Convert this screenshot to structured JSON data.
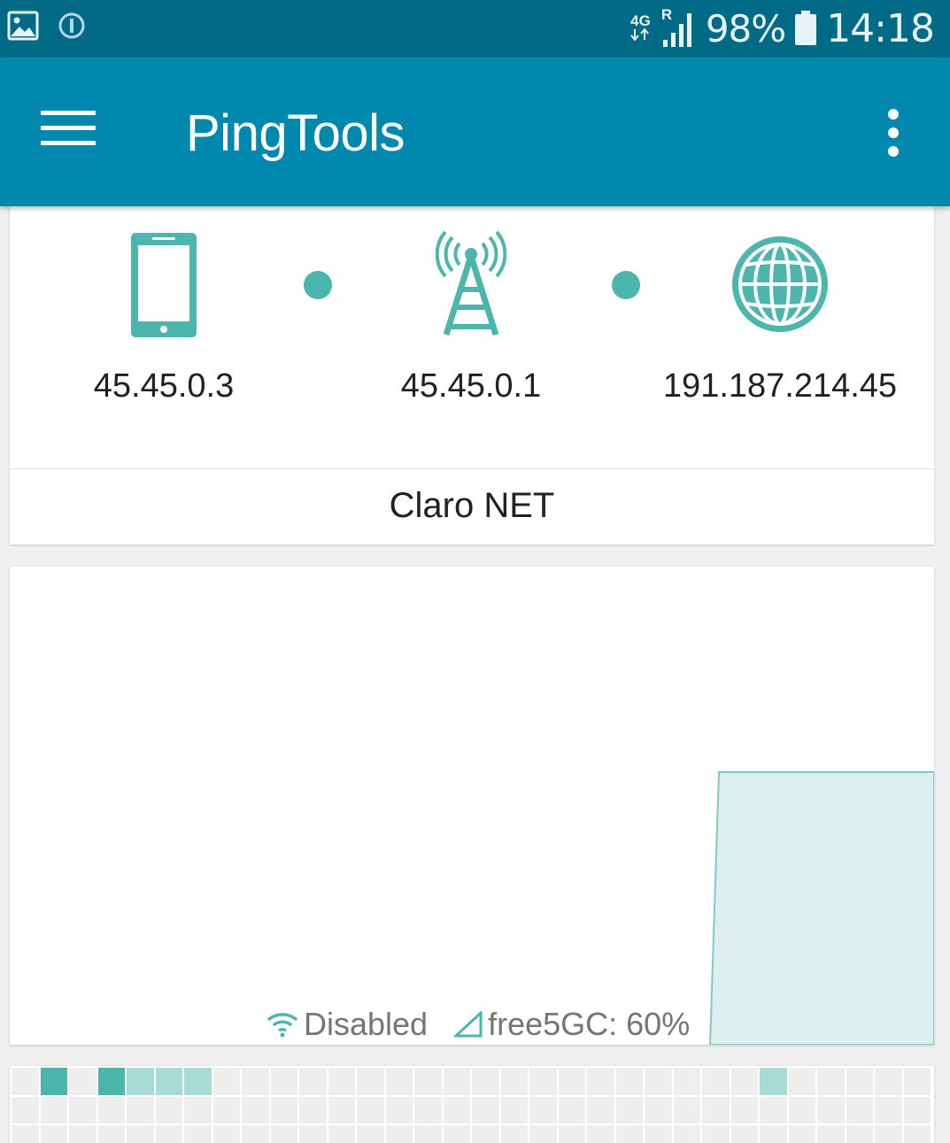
{
  "status_bar": {
    "network_type": "4G",
    "roaming": "R",
    "battery_percent": "98%",
    "time": "14:18",
    "icons": [
      "gallery-icon",
      "sync-icon",
      "data-arrows-icon",
      "signal-icon",
      "battery-icon"
    ]
  },
  "app_bar": {
    "title": "PingTools",
    "icons": [
      "menu-icon",
      "more-vert-icon"
    ]
  },
  "network": {
    "nodes": [
      {
        "icon": "phone-icon",
        "ip": "45.45.0.3"
      },
      {
        "icon": "cell-tower-icon",
        "ip": "45.45.0.1"
      },
      {
        "icon": "globe-icon",
        "ip": "191.187.214.45"
      }
    ],
    "carrier": "Claro NET"
  },
  "chart": {
    "legend": [
      {
        "icon": "wifi-icon",
        "label": "Disabled"
      },
      {
        "icon": "cell-signal-icon",
        "label": "free5GC: 60%"
      }
    ],
    "series_color": "#dcefee",
    "series_stroke": "#80cbc4"
  },
  "history_grid": {
    "columns": 32,
    "rows": 3,
    "first_row": [
      "empty",
      "strong",
      "empty",
      "strong",
      "weak",
      "weak",
      "weak",
      "empty",
      "empty",
      "empty",
      "empty",
      "empty",
      "empty",
      "empty",
      "empty",
      "empty",
      "empty",
      "empty",
      "empty",
      "empty",
      "empty",
      "empty",
      "empty",
      "empty",
      "empty",
      "empty",
      "weak",
      "empty",
      "empty",
      "empty",
      "empty",
      "empty"
    ]
  },
  "colors": {
    "status_bar": "#016a86",
    "app_bar": "#0088ae",
    "accent": "#4db6ac",
    "accent_light": "#a7dcd6"
  }
}
